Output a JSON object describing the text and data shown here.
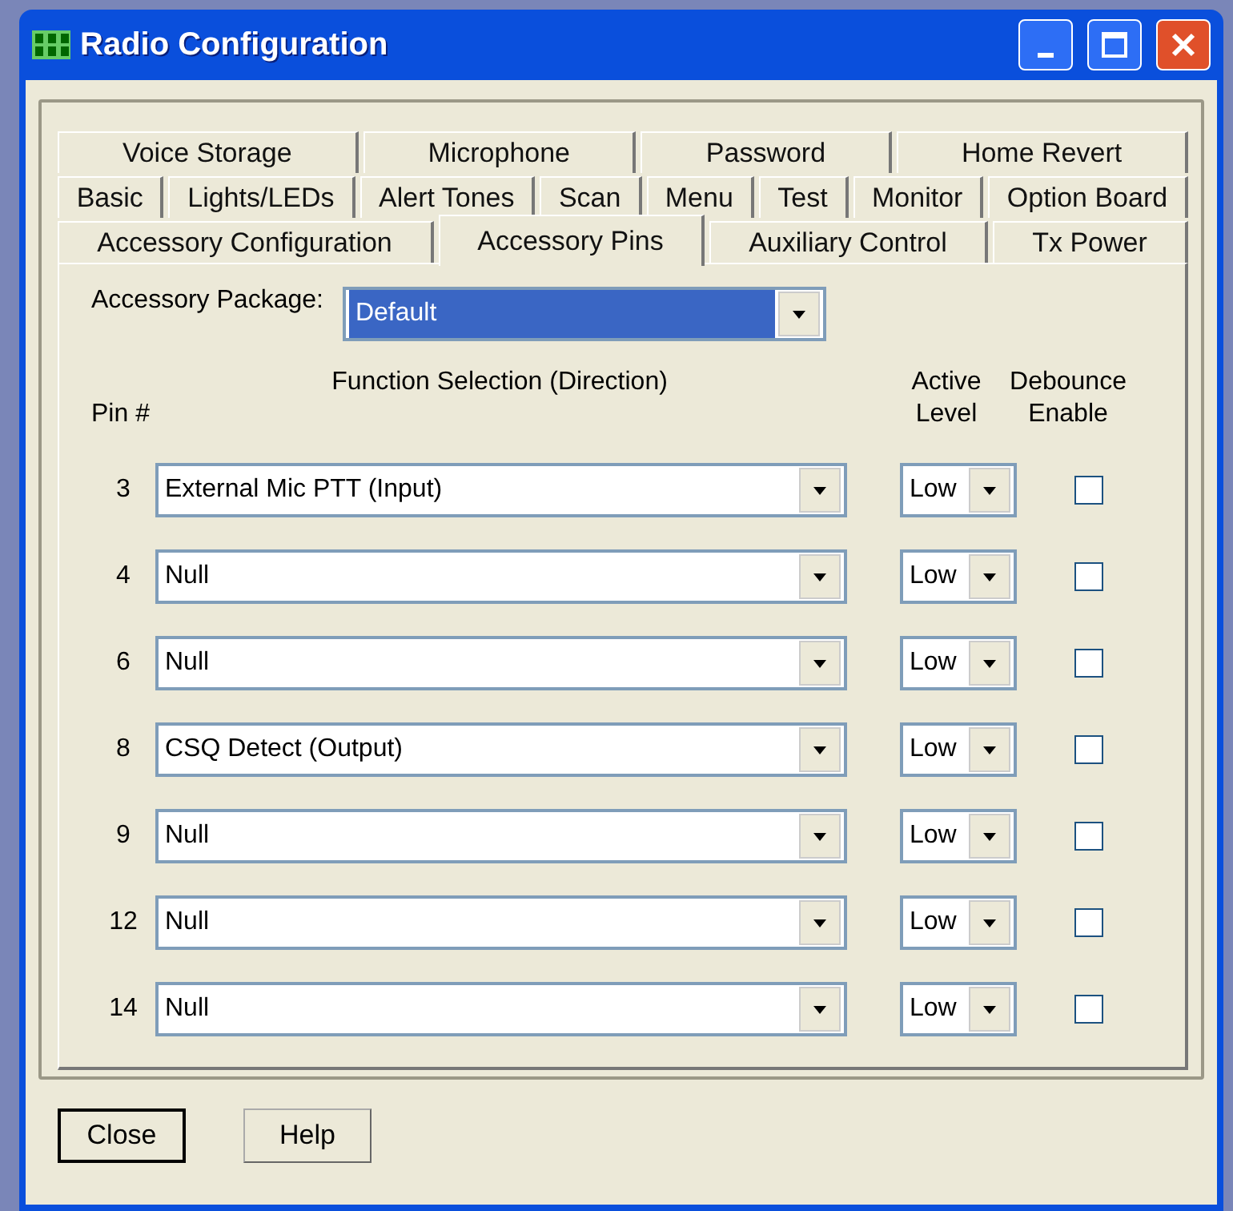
{
  "window": {
    "title": "Radio Configuration"
  },
  "tab_rows": [
    [
      {
        "label": "Voice Storage",
        "selected": false
      },
      {
        "label": "Microphone",
        "selected": false
      },
      {
        "label": "Password",
        "selected": false
      },
      {
        "label": "Home Revert",
        "selected": false
      }
    ],
    [
      {
        "label": "Basic",
        "selected": false
      },
      {
        "label": "Lights/LEDs",
        "selected": false
      },
      {
        "label": "Alert Tones",
        "selected": false
      },
      {
        "label": "Scan",
        "selected": false
      },
      {
        "label": "Menu",
        "selected": false
      },
      {
        "label": "Test",
        "selected": false
      },
      {
        "label": "Monitor",
        "selected": false
      },
      {
        "label": "Option Board",
        "selected": false
      }
    ],
    [
      {
        "label": "Accessory Configuration",
        "selected": false
      },
      {
        "label": "Accessory Pins",
        "selected": true
      },
      {
        "label": "Auxiliary Control",
        "selected": false
      },
      {
        "label": "Tx Power",
        "selected": false
      }
    ]
  ],
  "accessory_package": {
    "label": "Accessory Package:",
    "value": "Default",
    "highlighted": true
  },
  "columns": {
    "pin": "Pin #",
    "function": "Function Selection (Direction)",
    "active_level": [
      "Active",
      "Level"
    ],
    "debounce": [
      "Debounce",
      "Enable"
    ]
  },
  "pins": [
    {
      "pin": "3",
      "function": "External Mic PTT (Input)",
      "active_level": "Low",
      "debounce": false
    },
    {
      "pin": "4",
      "function": "Null",
      "active_level": "Low",
      "debounce": false
    },
    {
      "pin": "6",
      "function": "Null",
      "active_level": "Low",
      "debounce": false
    },
    {
      "pin": "8",
      "function": "CSQ Detect (Output)",
      "active_level": "Low",
      "debounce": false
    },
    {
      "pin": "9",
      "function": "Null",
      "active_level": "Low",
      "debounce": false
    },
    {
      "pin": "12",
      "function": "Null",
      "active_level": "Low",
      "debounce": false
    },
    {
      "pin": "14",
      "function": "Null",
      "active_level": "Low",
      "debounce": false
    }
  ],
  "buttons": [
    {
      "label": "Close",
      "default": true
    },
    {
      "label": "Help",
      "default": false
    }
  ]
}
